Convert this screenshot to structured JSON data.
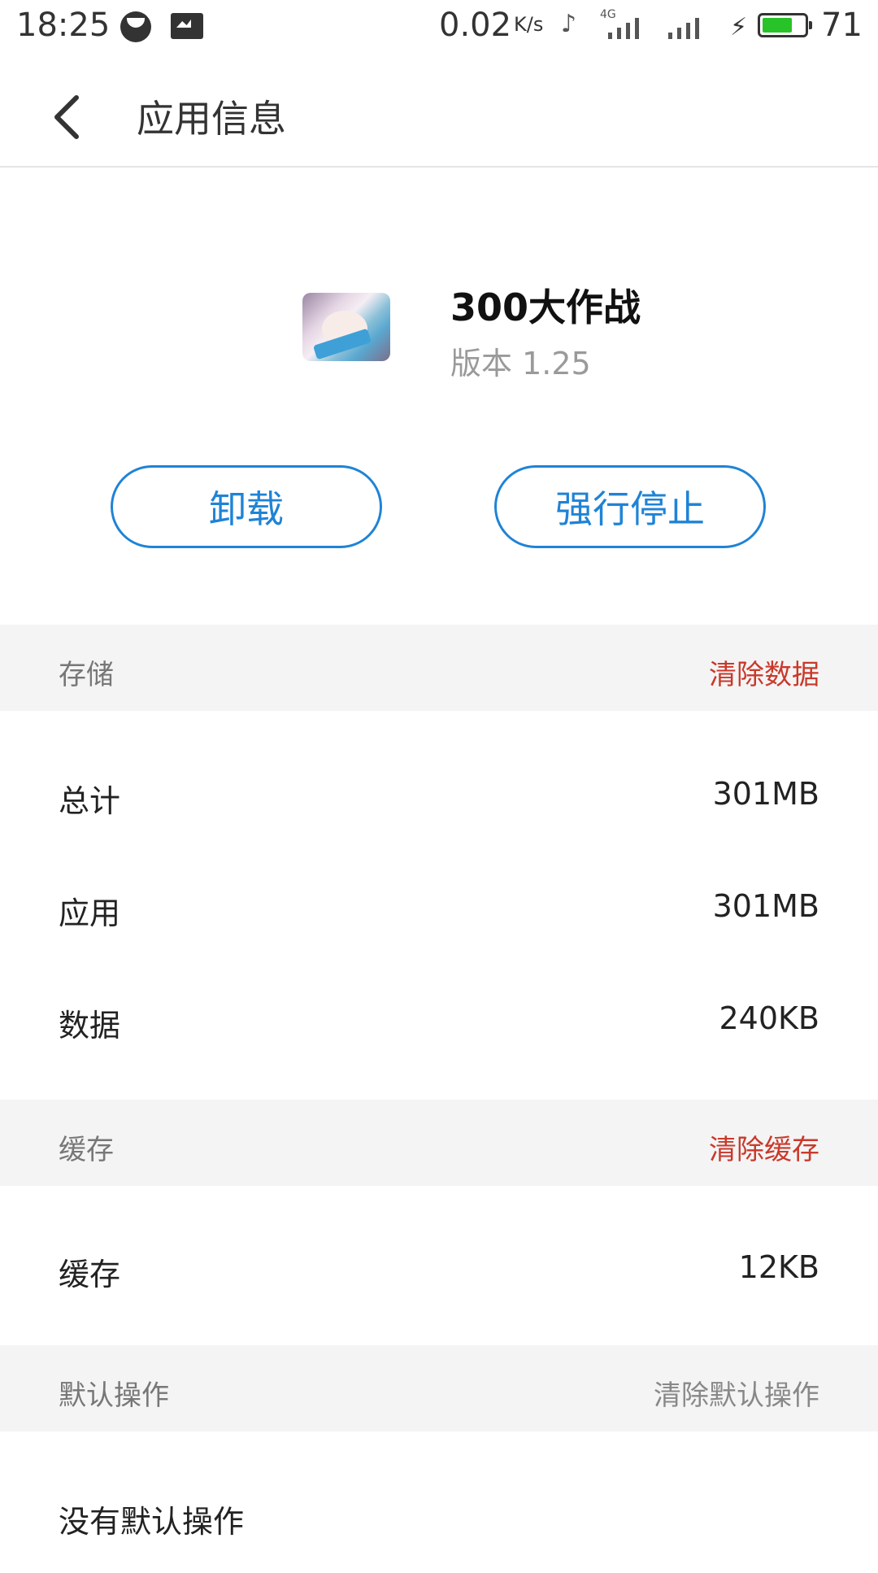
{
  "status_bar": {
    "time": "18:25",
    "net_speed": "0.02",
    "net_speed_unit": "K/s",
    "network_type": "4G",
    "battery_level": "71",
    "battery_fraction": 0.71,
    "icons": [
      "face-icon",
      "image-notification-icon",
      "music-off-icon",
      "signal-icon",
      "charging-icon",
      "battery-icon"
    ]
  },
  "header": {
    "title": "应用信息",
    "back_icon": "chevron-left-icon"
  },
  "app": {
    "name": "300大作战",
    "version": "版本 1.25",
    "icon": "app-icon"
  },
  "actions": {
    "uninstall": "卸载",
    "force_stop": "强行停止",
    "accent": "#1f83d6"
  },
  "storage": {
    "header": "存储",
    "action": "清除数据",
    "rows": [
      {
        "label": "总计",
        "value": "301MB"
      },
      {
        "label": "应用",
        "value": "301MB"
      },
      {
        "label": "数据",
        "value": "240KB"
      }
    ]
  },
  "cache": {
    "header": "缓存",
    "action": "清除缓存",
    "rows": [
      {
        "label": "缓存",
        "value": "12KB"
      }
    ]
  },
  "defaults": {
    "header": "默认操作",
    "action": "清除默认操作",
    "rows": [
      {
        "label": "没有默认操作"
      }
    ]
  },
  "colors": {
    "danger": "#c9392b",
    "section_bg": "#f4f4f4"
  }
}
